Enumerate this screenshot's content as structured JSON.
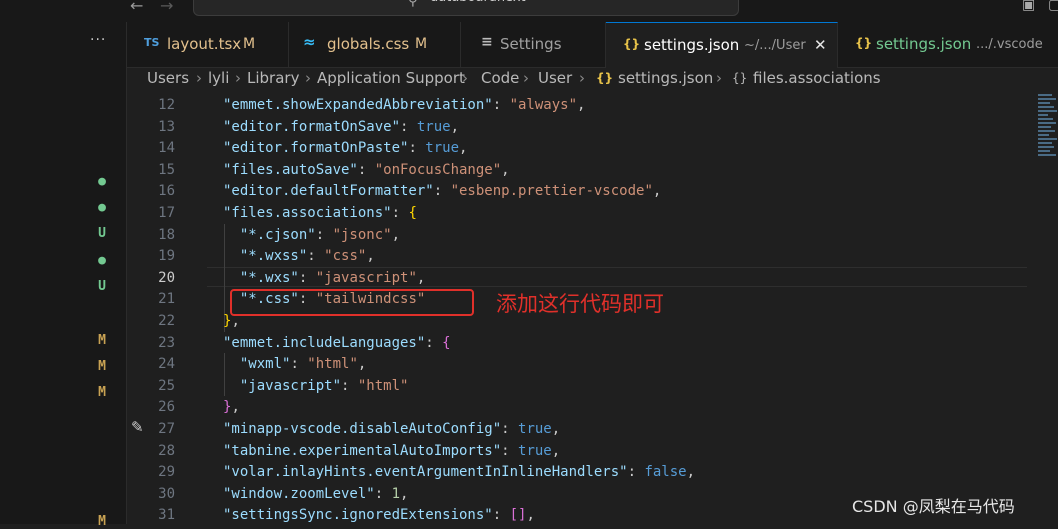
{
  "titlebar": {
    "search_text": "databoardnext"
  },
  "explorer": {
    "more_label": "···",
    "markers": [
      "●",
      "●",
      "U",
      "●",
      "U",
      "M",
      "M",
      "M",
      "M"
    ]
  },
  "tabs": [
    {
      "icon": "TS",
      "label": "layout.tsx",
      "modified": "M"
    },
    {
      "icon": "≈",
      "label": "globals.css",
      "modified": "M"
    },
    {
      "icon": "≡",
      "label": "Settings"
    },
    {
      "icon": "{}",
      "label": "settings.json",
      "description": "~/.../User",
      "close": "✕"
    },
    {
      "icon": "{}",
      "label": "settings.json",
      "description": ".../.vscode"
    }
  ],
  "breadcrumb": [
    "Users",
    "lyli",
    "Library",
    "Application Support",
    "Code",
    "User",
    "settings.json",
    "files.associations"
  ],
  "editor": {
    "lines": [
      {
        "n": "12",
        "code": [
          [
            "k",
            "\"emmet.showExpandedAbbreviation\""
          ],
          [
            "p",
            ": "
          ],
          [
            "s",
            "\"always\""
          ],
          [
            "p",
            ","
          ]
        ]
      },
      {
        "n": "13",
        "code": [
          [
            "k",
            "\"editor.formatOnSave\""
          ],
          [
            "p",
            ": "
          ],
          [
            "b",
            "true"
          ],
          [
            "p",
            ","
          ]
        ]
      },
      {
        "n": "14",
        "code": [
          [
            "k",
            "\"editor.formatOnPaste\""
          ],
          [
            "p",
            ": "
          ],
          [
            "b",
            "true"
          ],
          [
            "p",
            ","
          ]
        ]
      },
      {
        "n": "15",
        "code": [
          [
            "k",
            "\"files.autoSave\""
          ],
          [
            "p",
            ": "
          ],
          [
            "s",
            "\"onFocusChange\""
          ],
          [
            "p",
            ","
          ]
        ]
      },
      {
        "n": "16",
        "code": [
          [
            "k",
            "\"editor.defaultFormatter\""
          ],
          [
            "p",
            ": "
          ],
          [
            "s",
            "\"esbenp.prettier-vscode\""
          ],
          [
            "p",
            ","
          ]
        ]
      },
      {
        "n": "17",
        "code": [
          [
            "k",
            "\"files.associations\""
          ],
          [
            "p",
            ": "
          ],
          [
            "y",
            "{"
          ]
        ]
      },
      {
        "n": "18",
        "code": [
          [
            "p",
            "  "
          ],
          [
            "k",
            "\"*.cjson\""
          ],
          [
            "p",
            ": "
          ],
          [
            "s",
            "\"jsonc\""
          ],
          [
            "p",
            ","
          ]
        ]
      },
      {
        "n": "19",
        "code": [
          [
            "p",
            "  "
          ],
          [
            "k",
            "\"*.wxss\""
          ],
          [
            "p",
            ": "
          ],
          [
            "s",
            "\"css\""
          ],
          [
            "p",
            ","
          ]
        ]
      },
      {
        "n": "20",
        "code": [
          [
            "p",
            "  "
          ],
          [
            "k",
            "\"*.wxs\""
          ],
          [
            "p",
            ": "
          ],
          [
            "s",
            "\"javascript\""
          ],
          [
            "p",
            ","
          ]
        ]
      },
      {
        "n": "21",
        "code": [
          [
            "p",
            "  "
          ],
          [
            "k",
            "\"*.css\""
          ],
          [
            "p",
            ": "
          ],
          [
            "s",
            "\"tailwindcss\""
          ]
        ]
      },
      {
        "n": "22",
        "code": [
          [
            "y",
            "}"
          ],
          [
            "p",
            ","
          ]
        ]
      },
      {
        "n": "23",
        "code": [
          [
            "k",
            "\"emmet.includeLanguages\""
          ],
          [
            "p",
            ": "
          ],
          [
            "m",
            "{"
          ]
        ]
      },
      {
        "n": "24",
        "code": [
          [
            "p",
            "  "
          ],
          [
            "k",
            "\"wxml\""
          ],
          [
            "p",
            ": "
          ],
          [
            "s",
            "\"html\""
          ],
          [
            "p",
            ","
          ]
        ]
      },
      {
        "n": "25",
        "code": [
          [
            "p",
            "  "
          ],
          [
            "k",
            "\"javascript\""
          ],
          [
            "p",
            ": "
          ],
          [
            "s",
            "\"html\""
          ]
        ]
      },
      {
        "n": "26",
        "code": [
          [
            "m",
            "}"
          ],
          [
            "p",
            ","
          ]
        ]
      },
      {
        "n": "27",
        "code": [
          [
            "k",
            "\"minapp-vscode.disableAutoConfig\""
          ],
          [
            "p",
            ": "
          ],
          [
            "b",
            "true"
          ],
          [
            "p",
            ","
          ]
        ]
      },
      {
        "n": "28",
        "code": [
          [
            "k",
            "\"tabnine.experimentalAutoImports\""
          ],
          [
            "p",
            ": "
          ],
          [
            "b",
            "true"
          ],
          [
            "p",
            ","
          ]
        ]
      },
      {
        "n": "29",
        "code": [
          [
            "k",
            "\"volar.inlayHints.eventArgumentInInlineHandlers\""
          ],
          [
            "p",
            ": "
          ],
          [
            "b",
            "false"
          ],
          [
            "p",
            ","
          ]
        ]
      },
      {
        "n": "30",
        "code": [
          [
            "k",
            "\"window.zoomLevel\""
          ],
          [
            "p",
            ": "
          ],
          [
            "n",
            "1"
          ],
          [
            "p",
            ","
          ]
        ]
      },
      {
        "n": "31",
        "code": [
          [
            "k",
            "\"settingsSync.ignoredExtensions\""
          ],
          [
            "p",
            ": "
          ],
          [
            "m",
            "[]"
          ],
          [
            "p",
            ","
          ]
        ]
      }
    ]
  },
  "annotation": {
    "text": "添加这行代码即可"
  },
  "watermark": "CSDN @凤梨在马代码",
  "colors": {
    "accent": "#0078d4",
    "annotation_red": "#e0302a",
    "git_modified": "#c8a253",
    "git_untracked": "#73c991"
  }
}
